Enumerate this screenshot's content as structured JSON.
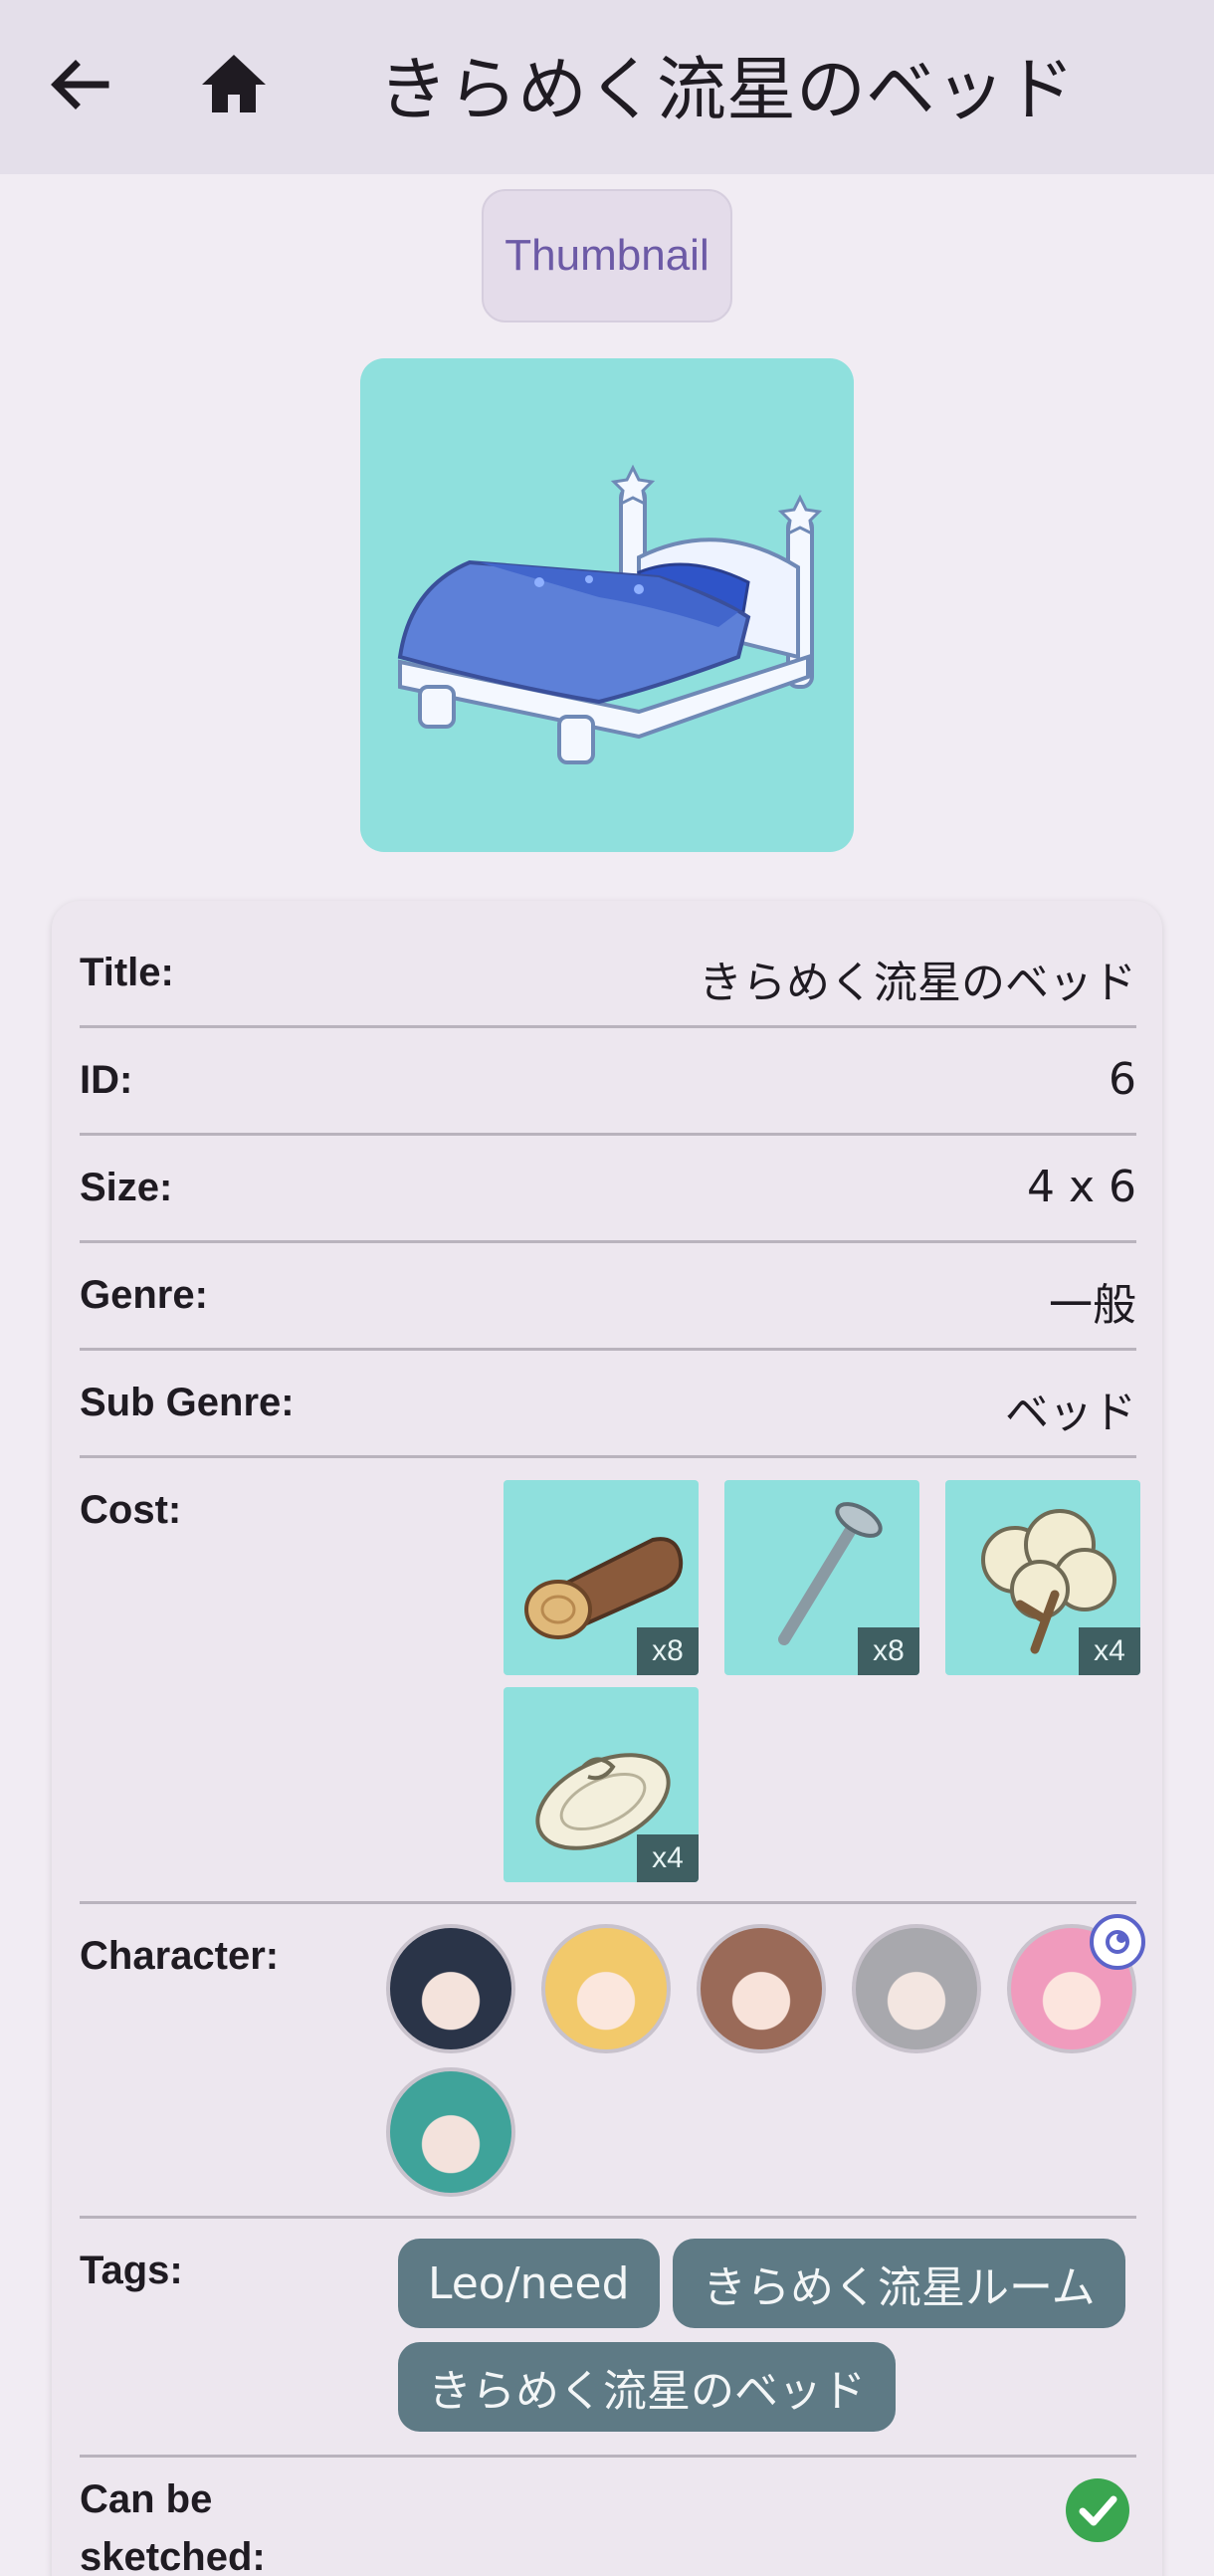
{
  "appbar": {
    "title": "きらめく流星のベッド",
    "back_icon": "arrow-left-icon",
    "home_icon": "home-icon"
  },
  "thumbnail_button": {
    "label": "Thumbnail"
  },
  "details": {
    "title_label": "Title:",
    "title_value": "きらめく流星のベッド",
    "id_label": "ID:",
    "id_value": "6",
    "size_label": "Size:",
    "size_value": "4 x 6",
    "genre_label": "Genre:",
    "genre_value": "一般",
    "subgenre_label": "Sub Genre:",
    "subgenre_value": "ベッド",
    "cost_label": "Cost:",
    "cost_items": [
      {
        "icon": "wood-log-icon",
        "qty": "x8"
      },
      {
        "icon": "nail-icon",
        "qty": "x8"
      },
      {
        "icon": "cotton-icon",
        "qty": "x4"
      },
      {
        "icon": "rope-icon",
        "qty": "x4"
      }
    ],
    "character_label": "Character:",
    "characters": [
      "character-1-avatar",
      "character-2-avatar",
      "character-3-avatar",
      "character-4-avatar",
      "character-5-avatar",
      "character-6-avatar"
    ],
    "tags_label": "Tags:",
    "tags": [
      "Leo/need",
      "きらめく流星ルーム",
      "きらめく流星のベッド"
    ],
    "sketch_label_1": "Can be",
    "sketch_label_2": "sketched:",
    "sketch_icon": "check-circle-icon"
  },
  "colors": {
    "accent": "#6c5aa6",
    "tile_bg": "#8fe0dd",
    "chip_bg": "#5e7a85",
    "check": "#3aa650"
  }
}
